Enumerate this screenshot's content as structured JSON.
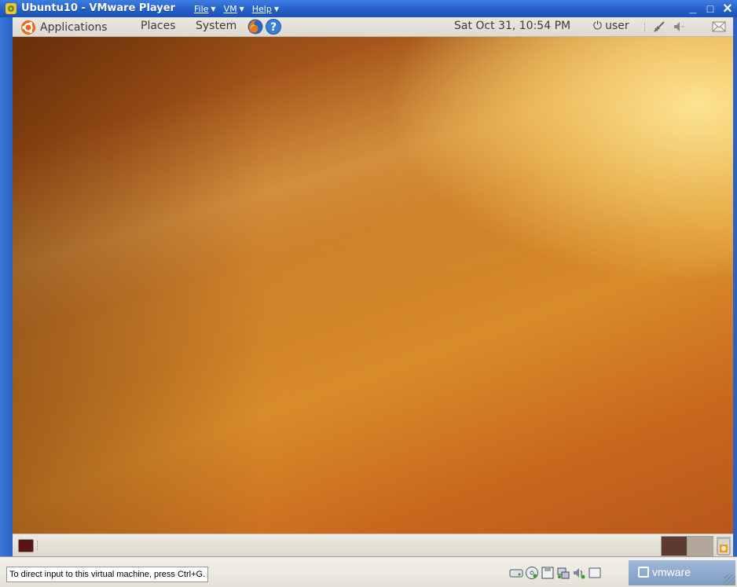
{
  "window": {
    "title": "Ubuntu10 - VMware Player",
    "menus": [
      {
        "label": "File"
      },
      {
        "label": "VM"
      },
      {
        "label": "Help"
      }
    ],
    "minimize": "_",
    "maximize": "□",
    "close": "×"
  },
  "top_panel": {
    "applications": "Applications",
    "places": "Places",
    "system": "System",
    "clock": "Sat Oct 31, 10:54 PM",
    "user": "user",
    "icons": [
      "ubuntu-logo-icon",
      "firefox-icon",
      "help-icon",
      "power-icon",
      "network-icon",
      "volume-icon",
      "mail-icon"
    ]
  },
  "bottom_panel": {
    "workspaces": 2,
    "icons": [
      "show-desktop-icon",
      "trash-icon"
    ]
  },
  "statusbar": {
    "hint": "To direct input to this virtual machine, press Ctrl+G.",
    "devices": [
      "hard-disk-icon",
      "cd-rom-icon",
      "floppy-icon",
      "network-adapter-icon",
      "sound-icon",
      "message-icon"
    ],
    "brand": "vmware"
  },
  "colors": {
    "titlebar": "#2560c8",
    "panel": "#e3e0d9",
    "wallpaper_dark": "#7a3a0c",
    "wallpaper_light": "#ffe9a0"
  }
}
